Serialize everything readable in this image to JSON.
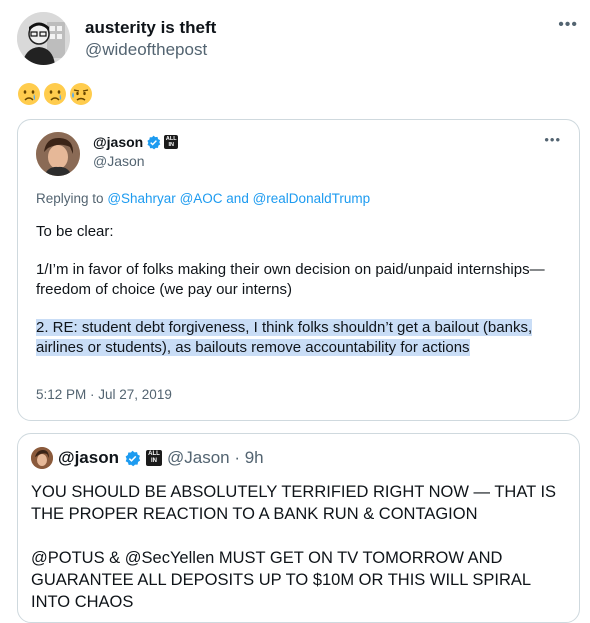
{
  "tweet": {
    "display_name": "austerity is theft",
    "handle": "@wideofthepost",
    "more_icon": "more-icon",
    "emojis": [
      "crying-face",
      "crying-face",
      "sad-but-relieved-face"
    ]
  },
  "screenshot": {
    "name": "@jason",
    "handle": "@Jason",
    "reply_prefix": "Replying to",
    "reply_mentions": [
      "@Shahryar",
      "@AOC",
      "and",
      "@realDonaldTrump"
    ],
    "paragraphs": [
      "To be clear:",
      "1/I’m in favor of folks making their own decision on paid/unpaid internships—freedom of choice (we pay our interns)"
    ],
    "highlighted_paragraph": "2. RE: student debt forgiveness, I think folks shouldn’t get a bailout (banks, airlines or students), as bailouts remove accountability for actions",
    "timestamp": "5:12 PM · Jul 27, 2019",
    "badge_text": "ALL IN"
  },
  "quote": {
    "name": "@jason",
    "handle_time": "@Jason · 9h",
    "paragraphs": [
      "YOU SHOULD BE ABSOLUTELY TERRIFIED RIGHT NOW  — THAT IS THE PROPER REACTION TO A BANK RUN & CONTAGION",
      "@POTUS & @SecYellen MUST GET ON TV TOMORROW AND GUARANTEE ALL DEPOSITS UP TO $10M OR THIS WILL SPIRAL INTO CHAOS"
    ]
  },
  "colors": {
    "link": "#1d9bf0",
    "verified": "#1d9bf0",
    "highlight": "#c9ddf6",
    "muted": "#536471"
  }
}
